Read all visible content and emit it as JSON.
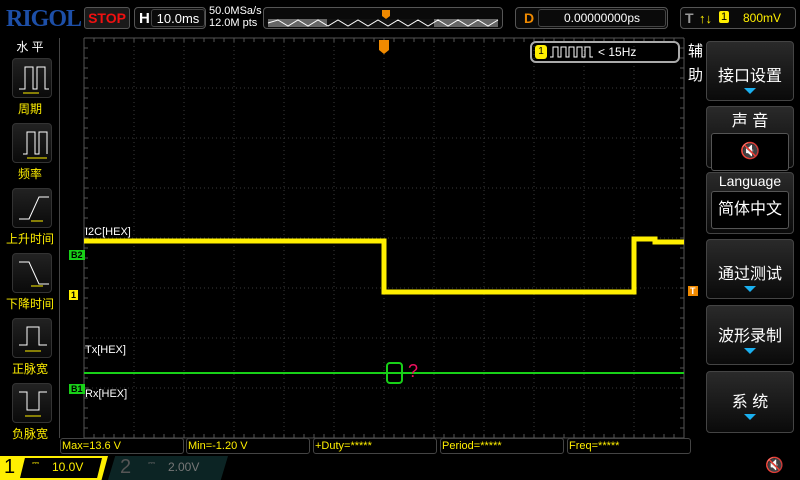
{
  "header": {
    "brand": "RIGOL",
    "run_state": "STOP",
    "horizontal": {
      "label": "H",
      "timebase": "10.0ms"
    },
    "sample_rate": "50.0MSa/s",
    "memory_depth": "12.0M pts",
    "delay": {
      "label": "D",
      "value": "0.00000000ps"
    },
    "trigger": {
      "label": "T",
      "edge": "↑↓",
      "source": "1",
      "level": "800mV"
    }
  },
  "left_menu": {
    "title": "水 平",
    "items": [
      {
        "label": "周期",
        "icon": "period-icon"
      },
      {
        "label": "频率",
        "icon": "frequency-icon"
      },
      {
        "label": "上升时间",
        "icon": "rise-time-icon"
      },
      {
        "label": "下降时间",
        "icon": "fall-time-icon"
      },
      {
        "label": "正脉宽",
        "icon": "positive-width-icon"
      },
      {
        "label": "负脉宽",
        "icon": "negative-width-icon"
      }
    ]
  },
  "right_menu": {
    "title": "辅助",
    "items": [
      {
        "label": "接口设置"
      },
      {
        "label": "声 音",
        "value": "🔇"
      },
      {
        "label": "Language",
        "value": "简体中文"
      },
      {
        "label": "通过测试"
      },
      {
        "label": "波形录制"
      },
      {
        "label": "系 统"
      }
    ]
  },
  "freq_counter": {
    "channel": "1",
    "value": "< 15Hz"
  },
  "traces": {
    "bus2_label": "I2C[HEX]",
    "tx_label": "Tx[HEX]",
    "rx_label": "Rx[HEX]",
    "b2_marker": "B2",
    "ch1_marker": "1",
    "b1_marker": "B1",
    "trigger_marker": "T",
    "decode_error": "?"
  },
  "measurements": [
    "Max=13.6 V",
    "Min=-1.20 V",
    "+Duty=*****",
    "Period=*****",
    "Freq=*****"
  ],
  "channels": [
    {
      "num": "1",
      "coupling": "⎓",
      "scale": "10.0V",
      "color": "#ffef00",
      "active": true
    },
    {
      "num": "2",
      "coupling": "⎓",
      "scale": "2.00V",
      "color": "#2a7a7a",
      "active": false
    }
  ],
  "colors": {
    "ch1": "#ffef00",
    "bus": "#18d018",
    "trigger": "#f08a00",
    "error": "#f01060"
  }
}
